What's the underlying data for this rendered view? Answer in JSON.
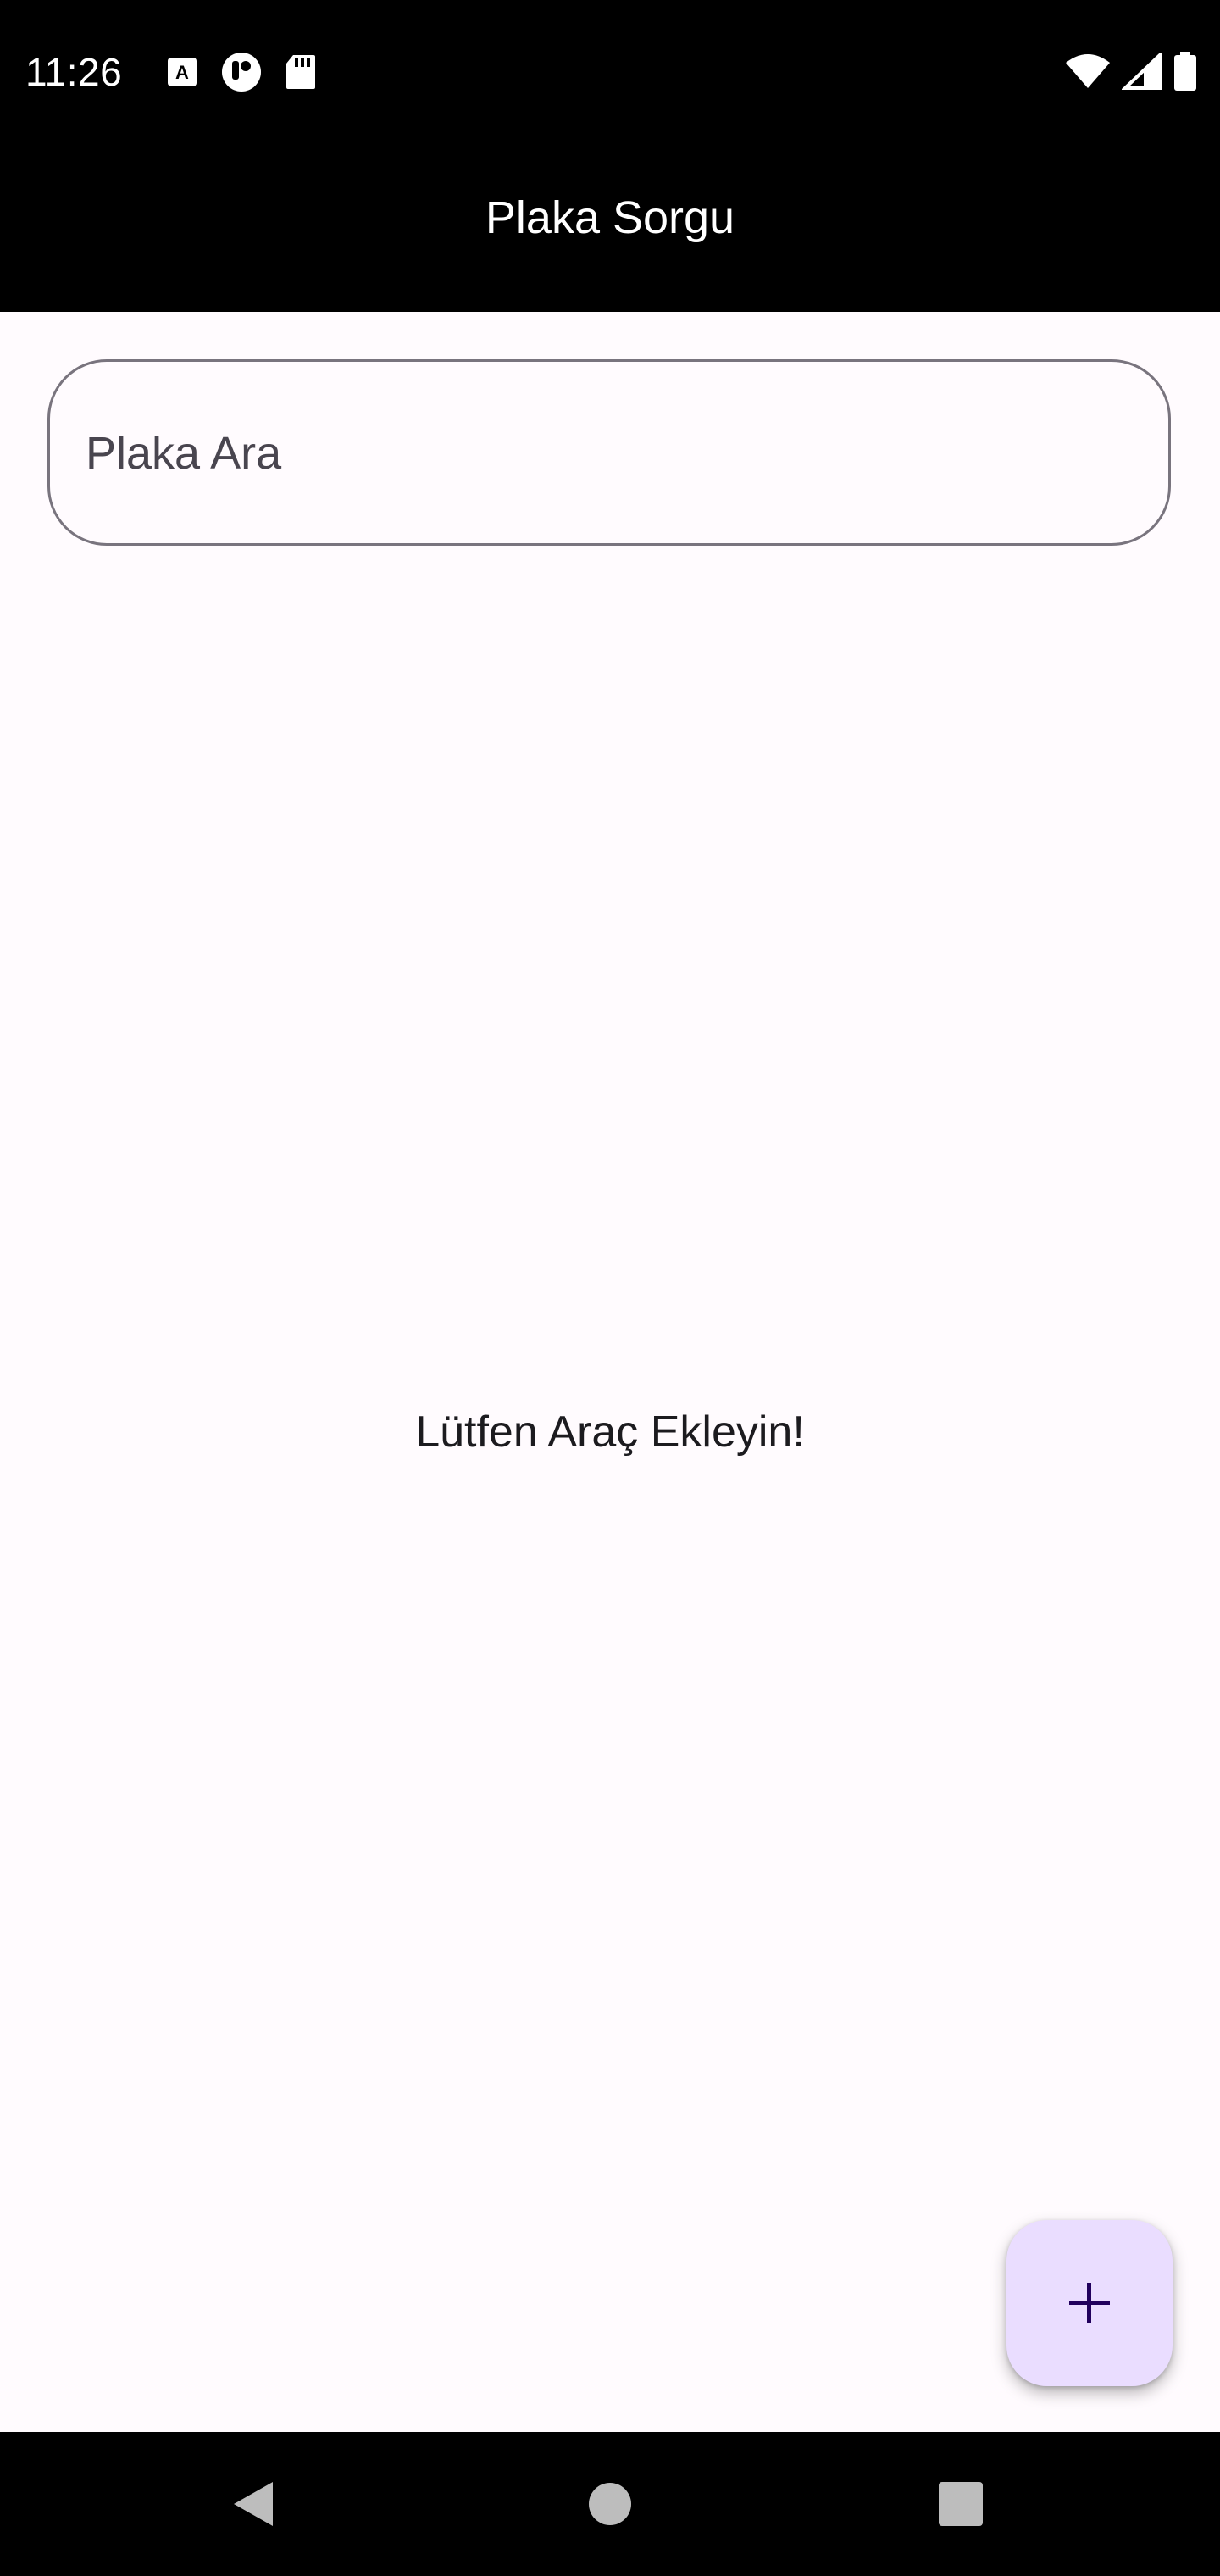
{
  "status_bar": {
    "time": "11:26",
    "left_icons": [
      "keyboard-a-icon",
      "accessibility-icon",
      "sd-card-icon"
    ],
    "right_icons": [
      "wifi-icon",
      "cell-signal-icon",
      "battery-icon"
    ]
  },
  "app_bar": {
    "title": "Plaka Sorgu"
  },
  "search": {
    "placeholder": "Plaka Ara",
    "value": ""
  },
  "content": {
    "empty_message": "Lütfen Araç Ekleyin!"
  },
  "fab": {
    "icon": "plus-icon",
    "color": "#eaddff"
  },
  "nav_bar": {
    "buttons": [
      "back-icon",
      "home-icon",
      "recents-icon"
    ]
  }
}
